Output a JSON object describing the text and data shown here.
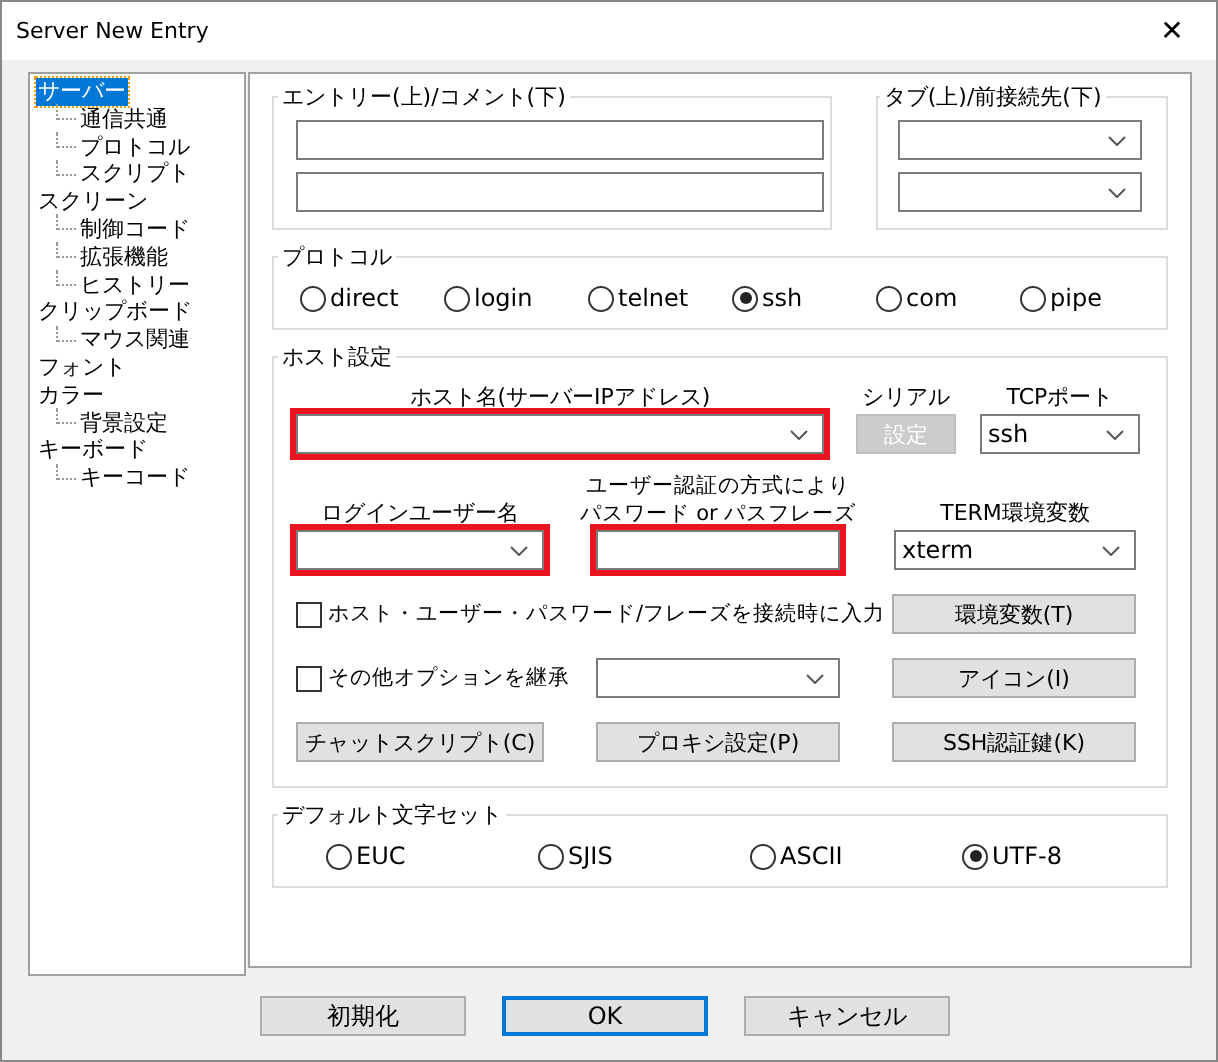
{
  "window": {
    "title": "Server New Entry",
    "close": "✕"
  },
  "tree": [
    {
      "label": "サーバー",
      "selected": true,
      "children": [
        {
          "label": "通信共通",
          "selected": false
        },
        {
          "label": "プロトコル",
          "selected": false
        },
        {
          "label": "スクリプト",
          "selected": false
        }
      ]
    },
    {
      "label": "スクリーン",
      "selected": false,
      "children": [
        {
          "label": "制御コード",
          "selected": false
        },
        {
          "label": "拡張機能",
          "selected": false
        },
        {
          "label": "ヒストリー",
          "selected": false
        }
      ]
    },
    {
      "label": "クリップボード",
      "selected": false,
      "children": [
        {
          "label": "マウス関連",
          "selected": false
        }
      ]
    },
    {
      "label": "フォント",
      "selected": false
    },
    {
      "label": "カラー",
      "selected": false,
      "children": [
        {
          "label": "背景設定",
          "selected": false
        }
      ]
    },
    {
      "label": "キーボード",
      "selected": false,
      "children": [
        {
          "label": "キーコード",
          "selected": false
        }
      ]
    }
  ],
  "entry": {
    "label": "エントリー(上)/コメント(下)"
  },
  "tab": {
    "label": "タブ(上)/前接続先(下)"
  },
  "protocol": {
    "label": "プロトコル",
    "options": [
      {
        "label": "direct",
        "selected": false
      },
      {
        "label": "login",
        "selected": false
      },
      {
        "label": "telnet",
        "selected": false
      },
      {
        "label": "ssh",
        "selected": true
      },
      {
        "label": "com",
        "selected": false
      },
      {
        "label": "pipe",
        "selected": false
      }
    ]
  },
  "host": {
    "label": "ホスト設定",
    "hostname": {
      "label": "ホスト名(サーバーIPアドレス)",
      "highlighted": true
    },
    "serial": {
      "label": "シリアル",
      "button": {
        "label": "設定",
        "disabled": true
      }
    },
    "tcp_port": {
      "label": "TCPポート",
      "value": "ssh"
    },
    "login_user": {
      "label": "ログインユーザー名",
      "highlighted": true
    },
    "password": {
      "label_lines": [
        "ユーザー認証の方式により",
        "パスワード or パスフレーズ"
      ],
      "highlighted": true
    },
    "term": {
      "label": "TERM環境変数",
      "value": "xterm"
    },
    "prompt_checkbox": {
      "label": "ホスト・ユーザー・パスワード/フレーズを接続時に入力",
      "checked": false
    },
    "env_button": "環境変数(T)",
    "inherit_checkbox": {
      "label": "その他オプションを継承",
      "checked": false
    },
    "icon_button": "アイコン(I)",
    "chat_button": "チャットスクリプト(C)",
    "proxy_button": "プロキシ設定(P)",
    "ssh_key_button": "SSH認証鍵(K)"
  },
  "charset": {
    "label": "デフォルト文字セット",
    "options": [
      {
        "label": "EUC",
        "selected": false
      },
      {
        "label": "SJIS",
        "selected": false
      },
      {
        "label": "ASCII",
        "selected": false
      },
      {
        "label": "UTF-8",
        "selected": true
      }
    ]
  },
  "buttons": [
    {
      "label": "初期化",
      "focused": false
    },
    {
      "label": "OK",
      "focused": true
    },
    {
      "label": "キャンセル",
      "focused": false
    }
  ]
}
